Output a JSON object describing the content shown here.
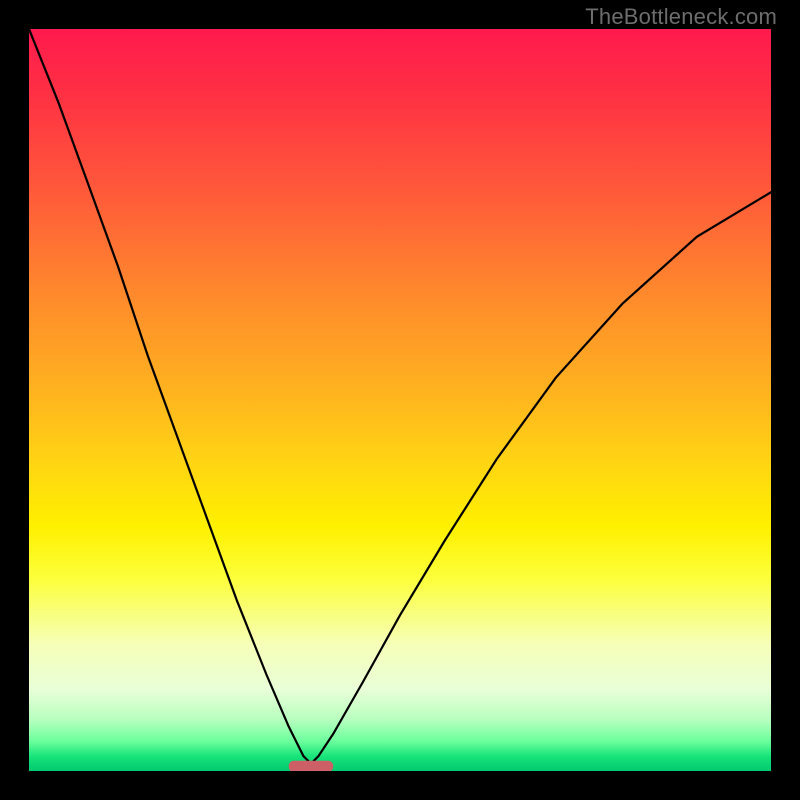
{
  "watermark": "TheBottleneck.com",
  "chart_data": {
    "type": "line",
    "title": "",
    "xlabel": "",
    "ylabel": "",
    "xlim": [
      0,
      100
    ],
    "ylim": [
      0,
      100
    ],
    "grid": false,
    "legend": false,
    "note": "V-shaped bottleneck curve over vertical red→green spectrum, minimum near x≈38",
    "series": [
      {
        "name": "bottleneck-curve",
        "x": [
          0,
          4,
          8,
          12,
          16,
          20,
          24,
          28,
          32,
          35,
          37,
          38,
          39,
          41,
          45,
          50,
          56,
          63,
          71,
          80,
          90,
          100
        ],
        "y": [
          100,
          90,
          79,
          68,
          56,
          45,
          34,
          23,
          13,
          6,
          2,
          1,
          2,
          5,
          12,
          21,
          31,
          42,
          53,
          63,
          72,
          78
        ]
      }
    ],
    "marker": {
      "shape": "rounded-bar",
      "x_center": 38,
      "x_halfwidth": 3,
      "y": 0.7,
      "color": "#cd5f66"
    },
    "background_gradient": {
      "direction": "vertical",
      "stops": [
        {
          "pos": 0.0,
          "color": "#ff1a4d"
        },
        {
          "pos": 0.5,
          "color": "#ffc018"
        },
        {
          "pos": 0.7,
          "color": "#fff000"
        },
        {
          "pos": 0.9,
          "color": "#d8ffc8"
        },
        {
          "pos": 1.0,
          "color": "#00c96f"
        }
      ]
    }
  }
}
